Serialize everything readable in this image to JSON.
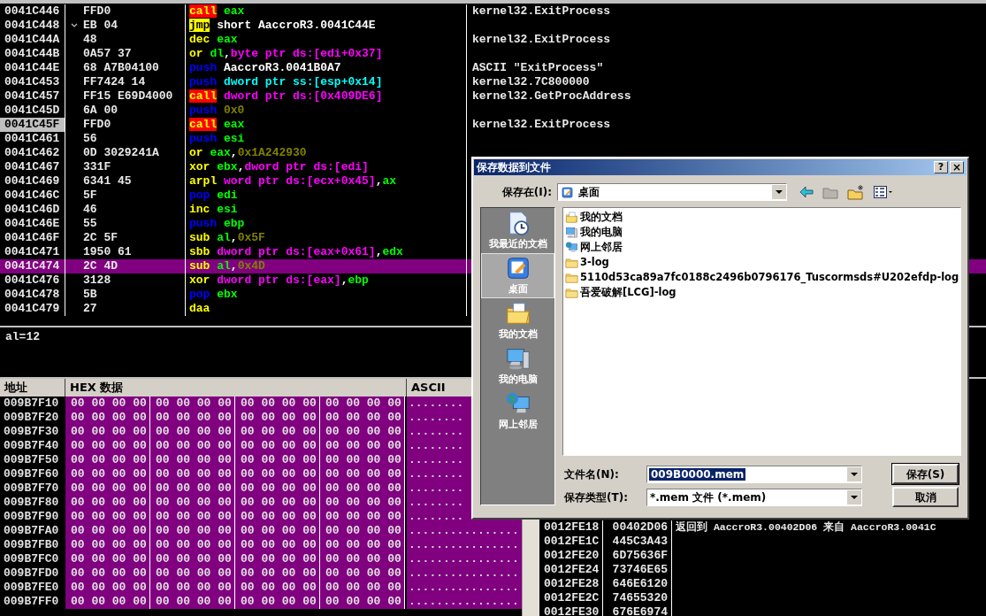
{
  "disassembly": {
    "rows": [
      {
        "address": "0041C446",
        "bytes": "FFD0",
        "jump_arrow": false,
        "instruction": [
          {
            "kind": "call",
            "text": "call"
          },
          {
            "kind": "reg",
            "text": " eax"
          }
        ],
        "comment": "kernel32.ExitProcess",
        "selected": false,
        "current": false
      },
      {
        "address": "0041C448",
        "bytes": "EB 04",
        "jump_arrow": true,
        "instruction": [
          {
            "kind": "jmp",
            "text": "jmp"
          },
          {
            "kind": "text",
            "text": " short AaccroR3.0041C44E"
          }
        ],
        "selected": false,
        "current": false
      },
      {
        "address": "0041C44A",
        "bytes": "48",
        "jump_arrow": false,
        "instruction": [
          {
            "kind": "op",
            "text": "dec"
          },
          {
            "kind": "reg",
            "text": " eax"
          }
        ],
        "comment": "kernel32.ExitProcess",
        "selected": false,
        "current": false
      },
      {
        "address": "0041C44B",
        "bytes": "0A57 37",
        "jump_arrow": false,
        "instruction": [
          {
            "kind": "op",
            "text": "or"
          },
          {
            "kind": "reg",
            "text": " dl"
          },
          {
            "kind": "text",
            "text": ","
          },
          {
            "kind": "mem",
            "text": "byte ptr ds:[edi+0x37]"
          }
        ],
        "selected": false,
        "current": false
      },
      {
        "address": "0041C44E",
        "bytes": "68 A7B04100",
        "jump_arrow": false,
        "instruction": [
          {
            "kind": "stack",
            "text": "push"
          },
          {
            "kind": "text",
            "text": " AaccroR3.0041B0A7"
          }
        ],
        "comment": "ASCII \"ExitProcess\"",
        "selected": false,
        "current": false
      },
      {
        "address": "0041C453",
        "bytes": "FF7424 14",
        "jump_arrow": false,
        "instruction": [
          {
            "kind": "stack",
            "text": "push"
          },
          {
            "kind": "ss",
            "text": " dword ptr ss:[esp+0x14]"
          }
        ],
        "comment": "kernel32.7C800000",
        "selected": false,
        "current": false
      },
      {
        "address": "0041C457",
        "bytes": "FF15 E69D4000",
        "jump_arrow": false,
        "instruction": [
          {
            "kind": "call",
            "text": "call"
          },
          {
            "kind": "mem",
            "text": " dword ptr ds:[0x409DE6]"
          }
        ],
        "comment": "kernel32.GetProcAddress",
        "selected": false,
        "current": false
      },
      {
        "address": "0041C45D",
        "bytes": "6A 00",
        "jump_arrow": false,
        "instruction": [
          {
            "kind": "stack",
            "text": "push"
          },
          {
            "kind": "imm",
            "text": " 0x0"
          }
        ],
        "selected": false,
        "current": false
      },
      {
        "address": "0041C45F",
        "bytes": "FFD0",
        "jump_arrow": false,
        "instruction": [
          {
            "kind": "call",
            "text": "call"
          },
          {
            "kind": "reg",
            "text": " eax"
          }
        ],
        "comment": "kernel32.ExitProcess",
        "selected": false,
        "current": true
      },
      {
        "address": "0041C461",
        "bytes": "56",
        "jump_arrow": false,
        "instruction": [
          {
            "kind": "stack",
            "text": "push"
          },
          {
            "kind": "reg",
            "text": " esi"
          }
        ],
        "selected": false,
        "current": false
      },
      {
        "address": "0041C462",
        "bytes": "0D 3029241A",
        "jump_arrow": false,
        "instruction": [
          {
            "kind": "op",
            "text": "or"
          },
          {
            "kind": "reg",
            "text": " eax"
          },
          {
            "kind": "text",
            "text": ","
          },
          {
            "kind": "imm",
            "text": "0x1A242930"
          }
        ],
        "selected": false,
        "current": false
      },
      {
        "address": "0041C467",
        "bytes": "331F",
        "jump_arrow": false,
        "instruction": [
          {
            "kind": "op",
            "text": "xor"
          },
          {
            "kind": "reg",
            "text": " ebx"
          },
          {
            "kind": "text",
            "text": ","
          },
          {
            "kind": "mem",
            "text": "dword ptr ds:[edi]"
          }
        ],
        "selected": false,
        "current": false
      },
      {
        "address": "0041C469",
        "bytes": "6341 45",
        "jump_arrow": false,
        "instruction": [
          {
            "kind": "op",
            "text": "arpl"
          },
          {
            "kind": "mem",
            "text": " word ptr ds:[ecx+0x45]"
          },
          {
            "kind": "text",
            "text": ","
          },
          {
            "kind": "reg",
            "text": "ax"
          }
        ],
        "selected": false,
        "current": false
      },
      {
        "address": "0041C46C",
        "bytes": "5F",
        "jump_arrow": false,
        "instruction": [
          {
            "kind": "stack",
            "text": "pop"
          },
          {
            "kind": "reg",
            "text": " edi"
          }
        ],
        "selected": false,
        "current": false
      },
      {
        "address": "0041C46D",
        "bytes": "46",
        "jump_arrow": false,
        "instruction": [
          {
            "kind": "op",
            "text": "inc"
          },
          {
            "kind": "reg",
            "text": " esi"
          }
        ],
        "selected": false,
        "current": false
      },
      {
        "address": "0041C46E",
        "bytes": "55",
        "jump_arrow": false,
        "instruction": [
          {
            "kind": "stack",
            "text": "push"
          },
          {
            "kind": "reg",
            "text": " ebp"
          }
        ],
        "selected": false,
        "current": false
      },
      {
        "address": "0041C46F",
        "bytes": "2C 5F",
        "jump_arrow": false,
        "instruction": [
          {
            "kind": "op",
            "text": "sub"
          },
          {
            "kind": "reg",
            "text": " al"
          },
          {
            "kind": "text",
            "text": ","
          },
          {
            "kind": "imm",
            "text": "0x5F"
          }
        ],
        "selected": false,
        "current": false
      },
      {
        "address": "0041C471",
        "bytes": "1950 61",
        "jump_arrow": false,
        "instruction": [
          {
            "kind": "op",
            "text": "sbb"
          },
          {
            "kind": "mem",
            "text": " dword ptr ds:[eax+0x61]"
          },
          {
            "kind": "text",
            "text": ","
          },
          {
            "kind": "reg",
            "text": "edx"
          }
        ],
        "selected": false,
        "current": false
      },
      {
        "address": "0041C474",
        "bytes": "2C 4D",
        "jump_arrow": false,
        "instruction": [
          {
            "kind": "op",
            "text": "sub"
          },
          {
            "kind": "reg",
            "text": " al"
          },
          {
            "kind": "text",
            "text": ","
          },
          {
            "kind": "imm",
            "text": "0x4D"
          }
        ],
        "selected": true,
        "current": false
      },
      {
        "address": "0041C476",
        "bytes": "3128",
        "jump_arrow": false,
        "instruction": [
          {
            "kind": "op",
            "text": "xor"
          },
          {
            "kind": "mem",
            "text": " dword ptr ds:[eax]"
          },
          {
            "kind": "text",
            "text": ","
          },
          {
            "kind": "reg",
            "text": "ebp"
          }
        ],
        "selected": false,
        "current": false
      },
      {
        "address": "0041C478",
        "bytes": "5B",
        "jump_arrow": false,
        "instruction": [
          {
            "kind": "stack",
            "text": "pop"
          },
          {
            "kind": "reg",
            "text": " ebx"
          }
        ],
        "selected": false,
        "current": false
      },
      {
        "address": "0041C479",
        "bytes": "27",
        "jump_arrow": false,
        "instruction": [
          {
            "kind": "op",
            "text": "daa"
          }
        ],
        "selected": false,
        "current": false
      }
    ]
  },
  "info": {
    "text": "al=12"
  },
  "dump": {
    "columns": [
      "地址",
      "HEX 数据",
      "ASCII"
    ],
    "rows": [
      {
        "address": "009B7F10",
        "hex": [
          "00 00 00 00",
          "00 00 00 00",
          "00 00 00 00",
          "00 00 00 00"
        ],
        "ascii": "........"
      },
      {
        "address": "009B7F20",
        "hex": [
          "00 00 00 00",
          "00 00 00 00",
          "00 00 00 00",
          "00 00 00 00"
        ],
        "ascii": "........"
      },
      {
        "address": "009B7F30",
        "hex": [
          "00 00 00 00",
          "00 00 00 00",
          "00 00 00 00",
          "00 00 00 00"
        ],
        "ascii": "........"
      },
      {
        "address": "009B7F40",
        "hex": [
          "00 00 00 00",
          "00 00 00 00",
          "00 00 00 00",
          "00 00 00 00"
        ],
        "ascii": "........"
      },
      {
        "address": "009B7F50",
        "hex": [
          "00 00 00 00",
          "00 00 00 00",
          "00 00 00 00",
          "00 00 00 00"
        ],
        "ascii": "........"
      },
      {
        "address": "009B7F60",
        "hex": [
          "00 00 00 00",
          "00 00 00 00",
          "00 00 00 00",
          "00 00 00 00"
        ],
        "ascii": "........"
      },
      {
        "address": "009B7F70",
        "hex": [
          "00 00 00 00",
          "00 00 00 00",
          "00 00 00 00",
          "00 00 00 00"
        ],
        "ascii": "........"
      },
      {
        "address": "009B7F80",
        "hex": [
          "00 00 00 00",
          "00 00 00 00",
          "00 00 00 00",
          "00 00 00 00"
        ],
        "ascii": "........"
      },
      {
        "address": "009B7F90",
        "hex": [
          "00 00 00 00",
          "00 00 00 00",
          "00 00 00 00",
          "00 00 00 00"
        ],
        "ascii": "........"
      },
      {
        "address": "009B7FA0",
        "hex": [
          "00 00 00 00",
          "00 00 00 00",
          "00 00 00 00",
          "00 00 00 00"
        ],
        "ascii": "................"
      },
      {
        "address": "009B7FB0",
        "hex": [
          "00 00 00 00",
          "00 00 00 00",
          "00 00 00 00",
          "00 00 00 00"
        ],
        "ascii": "................"
      },
      {
        "address": "009B7FC0",
        "hex": [
          "00 00 00 00",
          "00 00 00 00",
          "00 00 00 00",
          "00 00 00 00"
        ],
        "ascii": "................"
      },
      {
        "address": "009B7FD0",
        "hex": [
          "00 00 00 00",
          "00 00 00 00",
          "00 00 00 00",
          "00 00 00 00"
        ],
        "ascii": "................"
      },
      {
        "address": "009B7FE0",
        "hex": [
          "00 00 00 00",
          "00 00 00 00",
          "00 00 00 00",
          "00 00 00 00"
        ],
        "ascii": "................"
      },
      {
        "address": "009B7FF0",
        "hex": [
          "00 00 00 00",
          "00 00 00 00",
          "00 00 00 00",
          "00 00 00 00"
        ],
        "ascii": "................"
      }
    ]
  },
  "stack": {
    "rows": [
      {
        "address": "0012FE18",
        "value": "00402D06",
        "comment": "返回到 AaccroR3.00402D06 来自 AaccroR3.0041C"
      },
      {
        "address": "0012FE1C",
        "value": "445C3A43"
      },
      {
        "address": "0012FE20",
        "value": "6D75636F"
      },
      {
        "address": "0012FE24",
        "value": "73746E65"
      },
      {
        "address": "0012FE28",
        "value": "646E6120"
      },
      {
        "address": "0012FE2C",
        "value": "74655320"
      },
      {
        "address": "0012FE30",
        "value": "676E6974"
      }
    ]
  },
  "dialog": {
    "title": "保存数据到文件",
    "help_button": "?",
    "close_button": "×",
    "location": {
      "label": "保存在(I):",
      "value": "桌面"
    },
    "places": [
      {
        "label": "我最近的文档",
        "kind": "recent",
        "selected": false
      },
      {
        "label": "桌面",
        "kind": "desktop",
        "selected": true
      },
      {
        "label": "我的文档",
        "kind": "documents",
        "selected": false
      },
      {
        "label": "我的电脑",
        "kind": "computer",
        "selected": false
      },
      {
        "label": "网上邻居",
        "kind": "network",
        "selected": false
      }
    ],
    "files": [
      {
        "name": "我的文档",
        "kind": "documents"
      },
      {
        "name": "我的电脑",
        "kind": "computer"
      },
      {
        "name": "网上邻居",
        "kind": "network"
      },
      {
        "name": "3-log",
        "kind": "folder"
      },
      {
        "name": "5110d53ca89a7fc0188c2496b0796176_Tuscormsds#U202efdp-log",
        "kind": "folder"
      },
      {
        "name": "吾爱破解[LCG]-log",
        "kind": "folder"
      }
    ],
    "filename": {
      "label": "文件名(N):",
      "value": "009B0000.mem",
      "text_selected": true
    },
    "filetype": {
      "label": "保存类型(T):",
      "value": "*.mem 文件 (*.mem)"
    },
    "buttons": [
      "保存(S)",
      "取消"
    ]
  }
}
